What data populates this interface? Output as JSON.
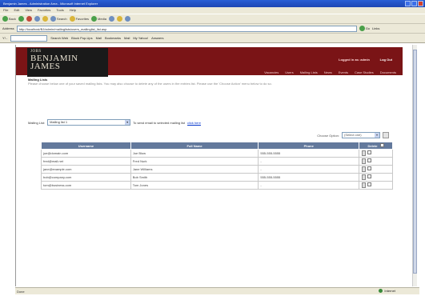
{
  "window": {
    "title": "Benjamin James - Administration Area - Microsoft Internet Explorer"
  },
  "menu": [
    "File",
    "Edit",
    "View",
    "Favorites",
    "Tools",
    "Help"
  ],
  "toolbar": {
    "back": "Back",
    "forward": "",
    "search": "Search",
    "favorites": "Favorites",
    "media": "Media"
  },
  "address": {
    "label": "Address",
    "url": "http://localhost/BJ/admin/mailinglists/users_mailinglist_list.asp",
    "go": "Go",
    "links": "Links"
  },
  "linksbar": {
    "search_label": "Y! -",
    "search_value": "",
    "search_web": "Search Web",
    "block": "Block Pop-Ups",
    "items": [
      "Mail",
      "Bookmarks",
      "Mail",
      "My Yahoo!",
      "Answers"
    ]
  },
  "header": {
    "logo_top": "JOBS",
    "logo_line1": "BENJAMIN",
    "logo_line2": "JAMES",
    "login_info": "Logged in as: admin",
    "logout": "Log Out",
    "nav": [
      "Vacancies",
      "Users",
      "Mailing Lists",
      "News",
      "Events",
      "Case Studies",
      "Documents"
    ]
  },
  "section": {
    "title": "Mailing Lists",
    "description": "Please choose below one of your saved mailing lists. You may also choose to delete any of the users in the entries list. Please use the 'Choose Action' menu below to do so."
  },
  "mailing": {
    "label": "Mailing List:",
    "selected": "Mailing list 1",
    "hint": "To send email to selected mailing list",
    "link": "click here"
  },
  "action": {
    "label": "Choose Option:",
    "selected": "(Select one)"
  },
  "table": {
    "headers": [
      "Username",
      "Full Name",
      "Phone",
      "Delete"
    ],
    "rows": [
      {
        "username": "joe@domain.com",
        "fullname": "Joe Blow",
        "phone": "555-555-5555"
      },
      {
        "username": "fred@mail.net",
        "fullname": "Fred Nurk",
        "phone": "-"
      },
      {
        "username": "jane@example.com",
        "fullname": "Jane Williams",
        "phone": "-"
      },
      {
        "username": "bob@company.com",
        "fullname": "Bob Smith",
        "phone": "555-555-5555"
      },
      {
        "username": "tom@business.com",
        "fullname": "Tom Jones",
        "phone": "-"
      }
    ]
  },
  "status": {
    "left": "Done",
    "zone": "Internet"
  },
  "colors": {
    "header_bg": "#7a1416",
    "table_header": "#63799c",
    "link": "#0033cc"
  }
}
